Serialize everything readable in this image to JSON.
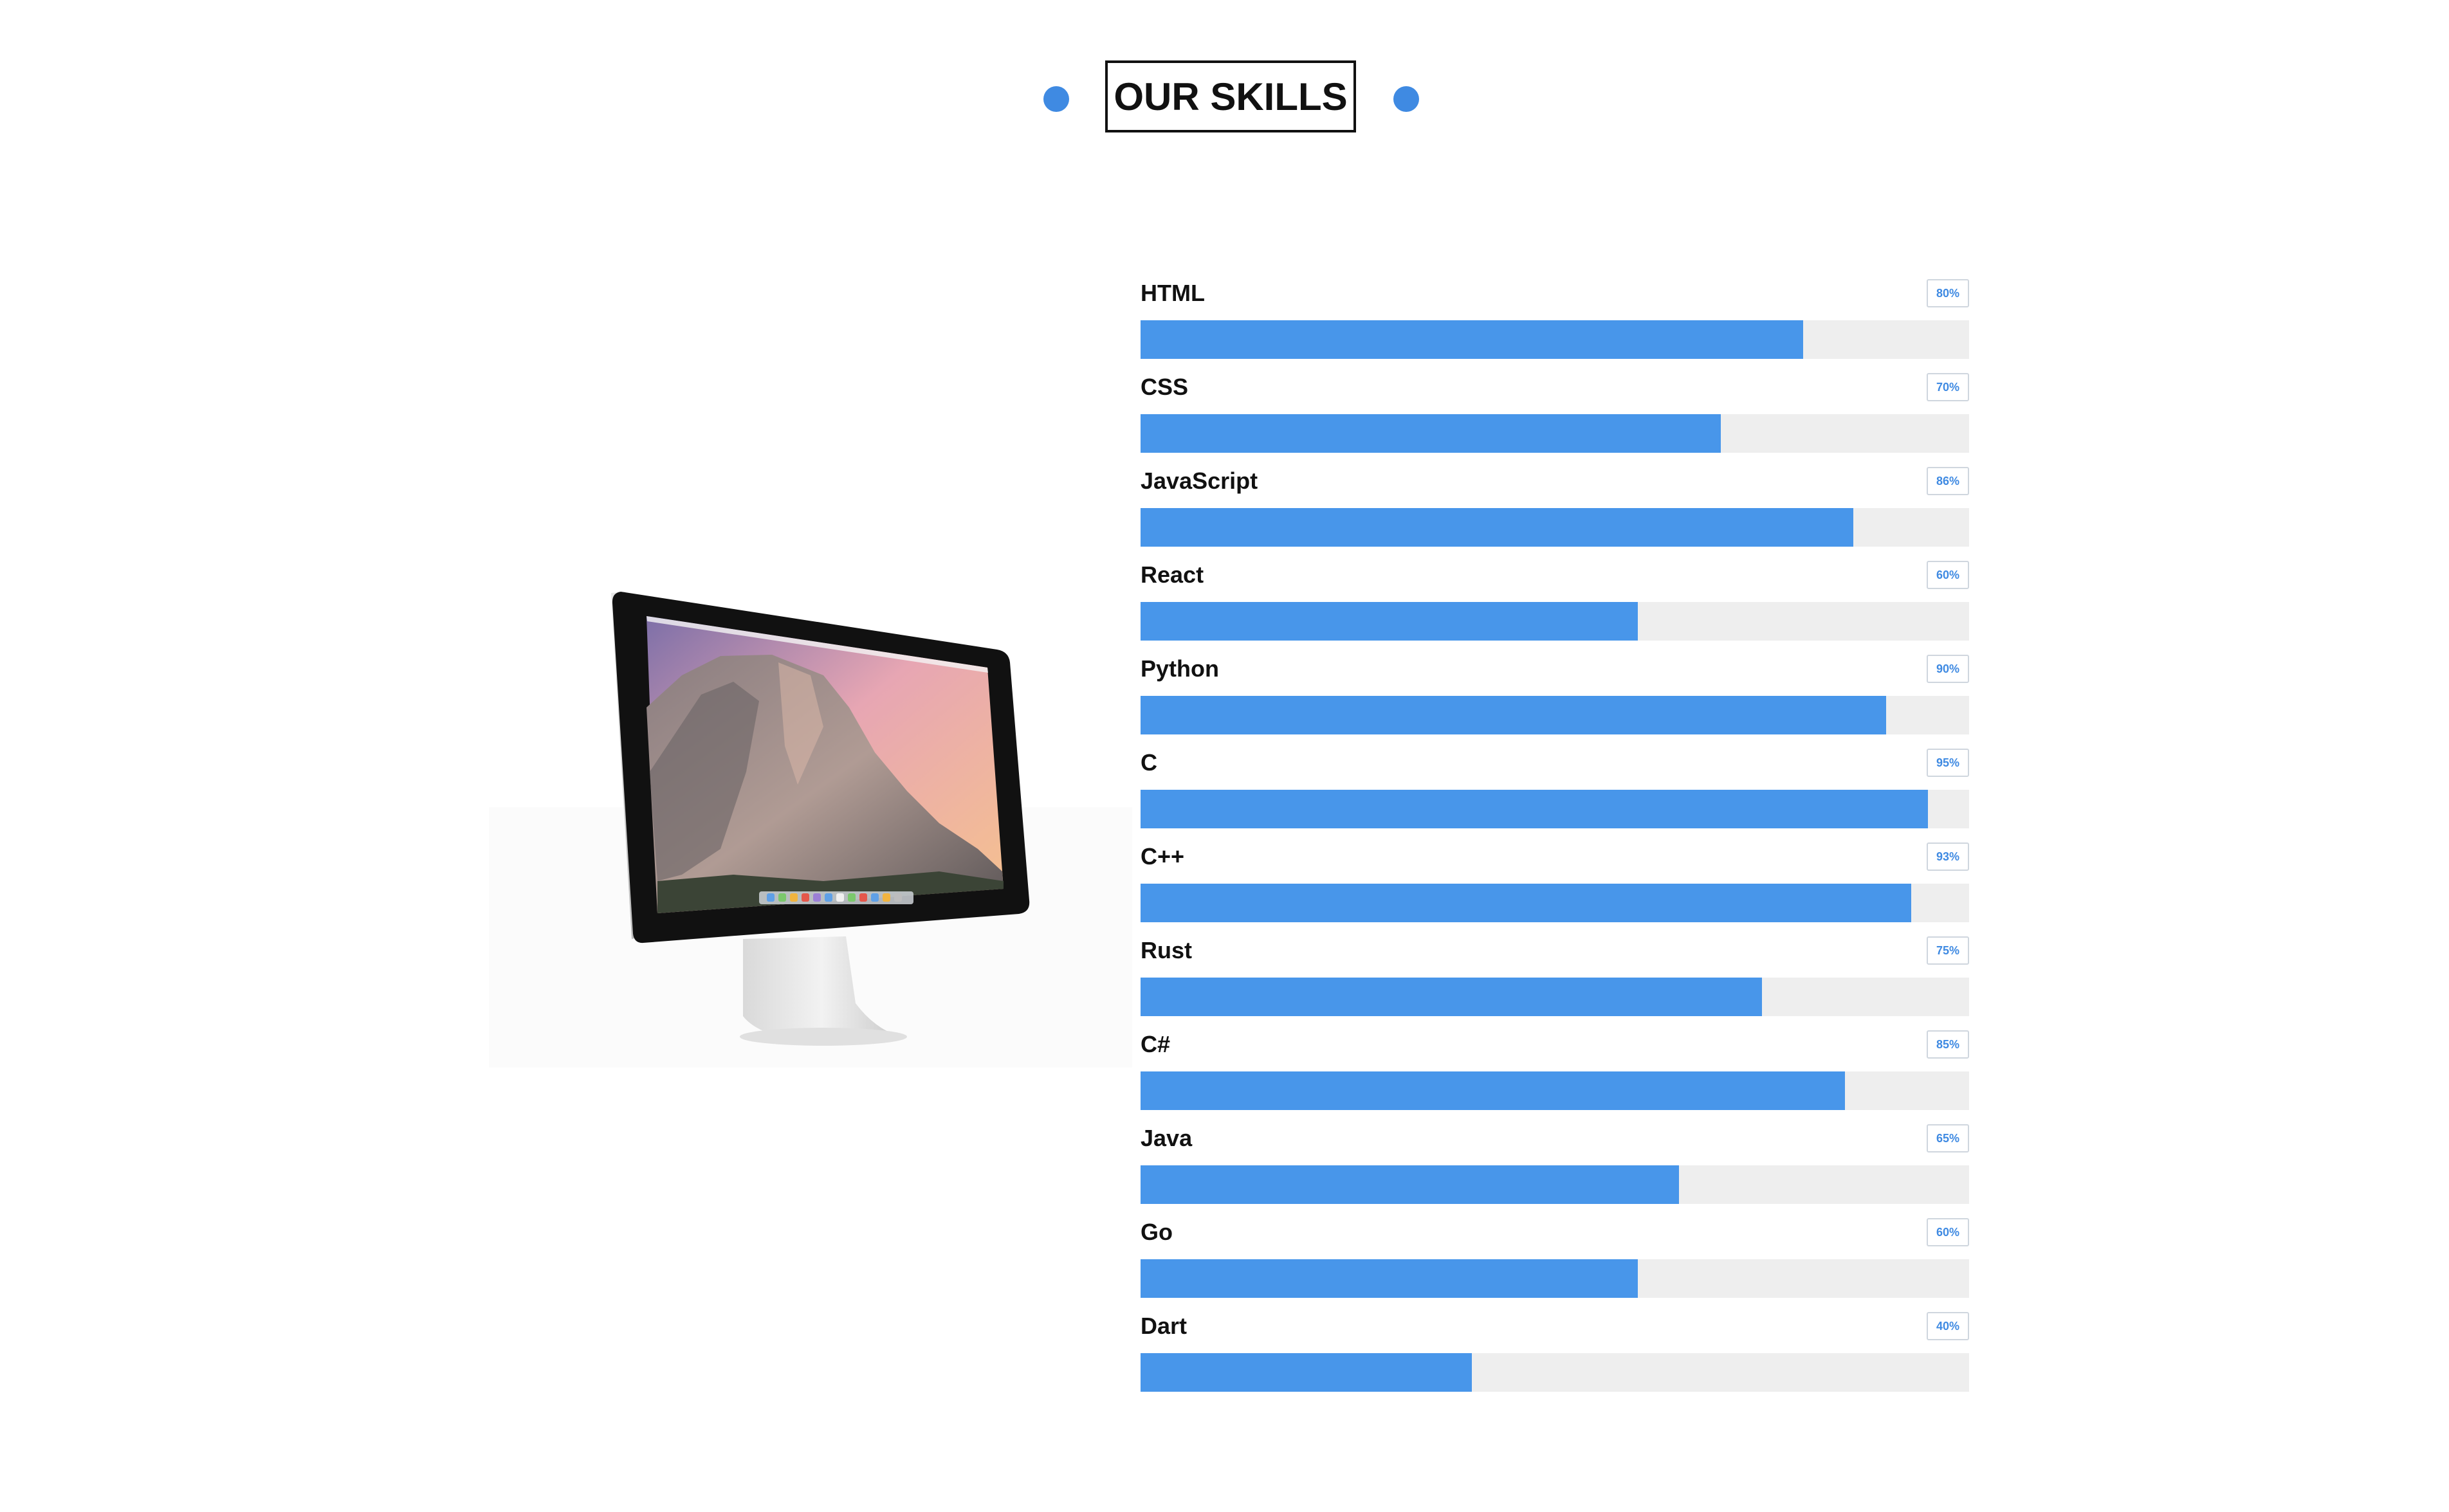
{
  "section": {
    "title": "OUR SKILLS"
  },
  "colors": {
    "accent": "#4896ea",
    "dot": "#3f8ae2",
    "track": "#eeeeee",
    "text": "#111111"
  },
  "illustration": {
    "icon": "desktop-monitor-icon"
  },
  "skills": [
    {
      "name": "HTML",
      "percent_label": "80%",
      "level": 0.8
    },
    {
      "name": "CSS",
      "percent_label": "70%",
      "level": 0.7
    },
    {
      "name": "JavaScript",
      "percent_label": "86%",
      "level": 0.86
    },
    {
      "name": "React",
      "percent_label": "60%",
      "level": 0.6
    },
    {
      "name": "Python",
      "percent_label": "90%",
      "level": 0.9
    },
    {
      "name": "C",
      "percent_label": "95%",
      "level": 0.95
    },
    {
      "name": "C++",
      "percent_label": "93%",
      "level": 0.93
    },
    {
      "name": "Rust",
      "percent_label": "75%",
      "level": 0.75
    },
    {
      "name": "C#",
      "percent_label": "85%",
      "level": 0.85
    },
    {
      "name": "Java",
      "percent_label": "65%",
      "level": 0.65
    },
    {
      "name": "Go",
      "percent_label": "60%",
      "level": 0.6
    },
    {
      "name": "Dart",
      "percent_label": "40%",
      "level": 0.4
    }
  ]
}
